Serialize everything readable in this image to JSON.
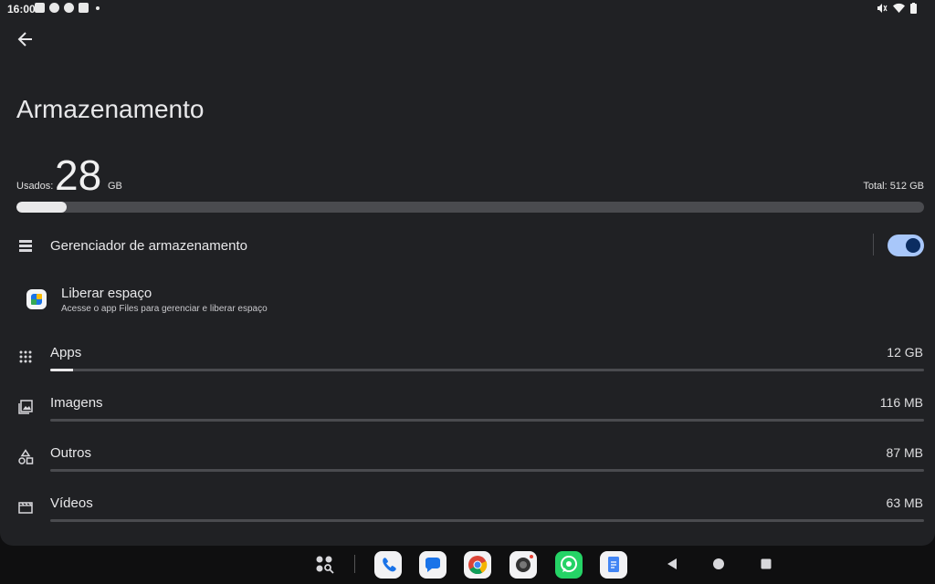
{
  "status_bar": {
    "time": "16:00",
    "notification_icons": [
      "mail-icon",
      "whatsapp-icon",
      "whatsapp-icon",
      "youtube-icon",
      "dot-icon"
    ],
    "system_icons": [
      "mute-icon",
      "wifi-icon",
      "battery-icon"
    ]
  },
  "page": {
    "title": "Armazenamento",
    "back_icon": "arrow-back-icon"
  },
  "usage": {
    "used_label": "Usados:",
    "used_value": "28",
    "used_unit": "GB",
    "total_text": "Total: 512 GB",
    "used_fraction": 0.055
  },
  "storage_manager": {
    "label": "Gerenciador de armazenamento",
    "icon": "storage-list-icon",
    "toggle_on": true
  },
  "free_space": {
    "title": "Liberar espaço",
    "subtitle": "Acesse o app Files para gerenciar e liberar espaço",
    "icon": "files-app-icon"
  },
  "categories": [
    {
      "label": "Apps",
      "value": "12 GB",
      "icon": "apps-grid-icon",
      "fraction": 0.026
    },
    {
      "label": "Imagens",
      "value": "116 MB",
      "icon": "image-icon",
      "fraction": 0.0
    },
    {
      "label": "Outros",
      "value": "87 MB",
      "icon": "shapes-icon",
      "fraction": 0.0
    },
    {
      "label": "Vídeos",
      "value": "63 MB",
      "icon": "video-icon",
      "fraction": 0.0
    }
  ],
  "dock": {
    "apps": [
      "app-drawer-icon",
      "phone-icon",
      "messages-icon",
      "chrome-icon",
      "camera-icon",
      "whatsapp-icon",
      "docs-icon"
    ],
    "nav": [
      "back-nav-icon",
      "home-nav-icon",
      "recents-nav-icon"
    ]
  },
  "colors": {
    "background": "#202124",
    "accent": "#a8c7fa",
    "bar_fill": "#e9e9ea",
    "bar_track": "#4a4b4f"
  }
}
